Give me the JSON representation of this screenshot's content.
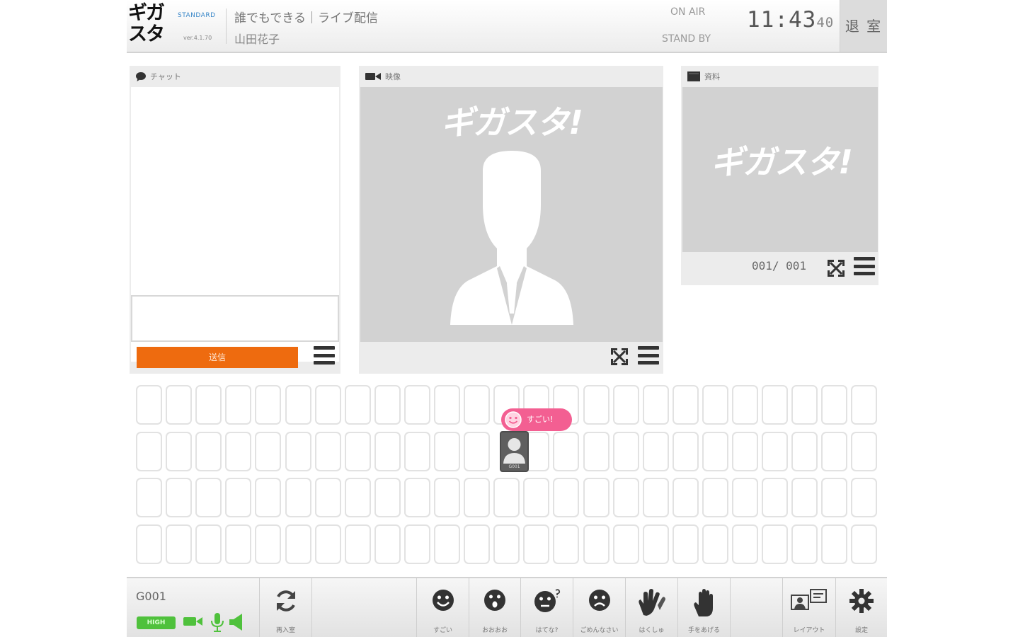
{
  "header": {
    "logo_text": "ギガ\nスタ",
    "plan": "STANDARD",
    "version": "ver.4.1.70",
    "room_title": "誰でもできる｜ライブ配信",
    "user_name": "山田花子",
    "on_air": "ON AIR",
    "stand_by": "STAND BY",
    "clock_main": "11:43",
    "clock_seconds": "40",
    "exit_label": "退 室"
  },
  "chat": {
    "title": "チャット",
    "input_value": "",
    "send_label": "送信"
  },
  "video": {
    "title": "映像",
    "brand": "ギガスタ!"
  },
  "document": {
    "title": "資料",
    "brand": "ギガスタ!",
    "page_counter": "001/ 001"
  },
  "seats": {
    "occupied_seat_id": "G001",
    "reaction_text": "すごい!"
  },
  "toolbar": {
    "seat_code": "G001",
    "quality": "HIGH",
    "buttons": {
      "reconnect": "再入室",
      "great": "すごい",
      "surprised": "おおおお",
      "question": "はてな?",
      "sorry": "ごめんなさい",
      "clap": "はくしゅ",
      "raise_hand": "手をあげる",
      "layout": "レイアウト",
      "settings": "設定"
    }
  },
  "colors": {
    "accent_orange": "#ee6b0f",
    "reaction_pink": "#f35f92",
    "quality_green": "#4fc13c",
    "plan_blue": "#3a87c8"
  }
}
